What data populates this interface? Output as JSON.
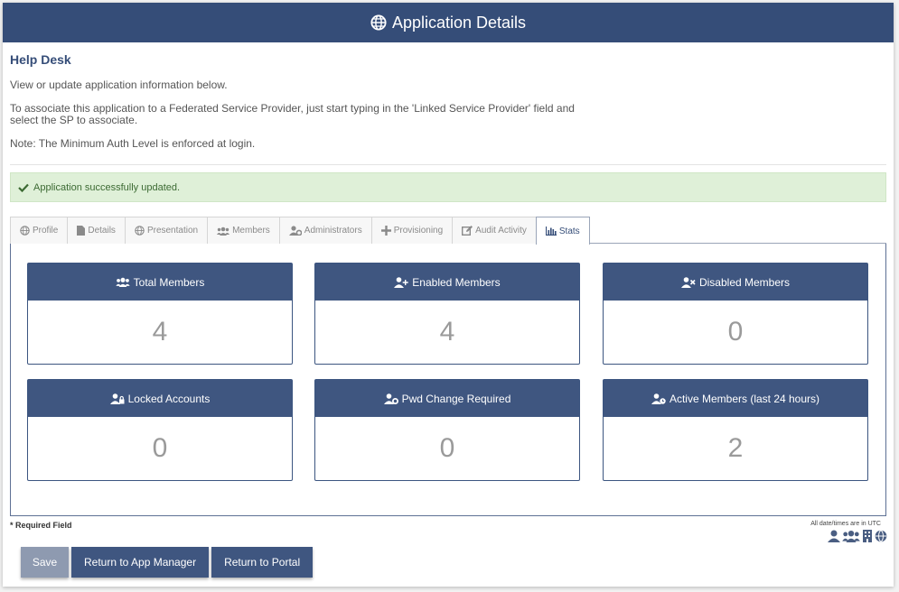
{
  "header": {
    "title": "Application Details",
    "icon": "globe-icon"
  },
  "app_name": "Help Desk",
  "intro": {
    "p1": "View or update application information below.",
    "p2": "To associate this application to a Federated Service Provider, just start typing in the 'Linked Service Provider' field and select the SP to associate.",
    "p3": "Note: The Minimum Auth Level is enforced at login."
  },
  "alert": {
    "text": "Application successfully updated.",
    "icon": "check-icon"
  },
  "tabs": [
    {
      "label": "Profile",
      "icon": "globe-icon"
    },
    {
      "label": "Details",
      "icon": "document-icon"
    },
    {
      "label": "Presentation",
      "icon": "globe-icon"
    },
    {
      "label": "Members",
      "icon": "users-icon"
    },
    {
      "label": "Administrators",
      "icon": "user-gear-icon"
    },
    {
      "label": "Provisioning",
      "icon": "plus-icon"
    },
    {
      "label": "Audit Activity",
      "icon": "edit-icon"
    },
    {
      "label": "Stats",
      "icon": "bar-chart-icon",
      "active": true
    }
  ],
  "cards": [
    {
      "title": "Total Members",
      "value": "4",
      "icon": "users-icon"
    },
    {
      "title": "Enabled Members",
      "value": "4",
      "icon": "user-plus-icon"
    },
    {
      "title": "Disabled Members",
      "value": "0",
      "icon": "user-times-icon"
    },
    {
      "title": "Locked Accounts",
      "value": "0",
      "icon": "user-lock-icon"
    },
    {
      "title": "Pwd Change Required",
      "value": "0",
      "icon": "user-gear-icon"
    },
    {
      "title": "Active Members (last 24 hours)",
      "value": "2",
      "icon": "user-clock-icon"
    }
  ],
  "footer": {
    "required": "* Required Field",
    "utc_note": "All date/times are in UTC"
  },
  "buttons": {
    "save": "Save",
    "return_app_manager": "Return to App Manager",
    "return_portal": "Return to Portal"
  },
  "colors": {
    "brand": "#354d78",
    "card_header": "#3f5680",
    "alert_bg": "#dff0d8"
  }
}
